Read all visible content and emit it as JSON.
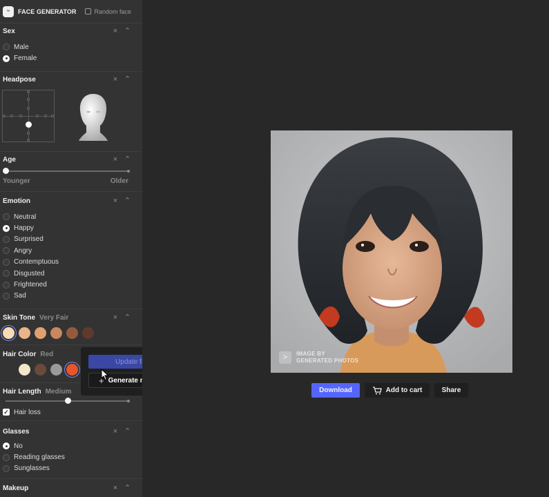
{
  "app": {
    "logo_glyph": "ᵕ",
    "title": "FACE GENERATOR",
    "random_face": "Random face"
  },
  "controls": {
    "close": "×",
    "collapse": "⌃"
  },
  "sex": {
    "title": "Sex",
    "options": [
      {
        "label": "Male",
        "selected": false
      },
      {
        "label": "Female",
        "selected": true
      }
    ]
  },
  "headpose": {
    "title": "Headpose"
  },
  "age": {
    "title": "Age",
    "min_label": "Younger",
    "max_label": "Older",
    "value": 0
  },
  "emotion": {
    "title": "Emotion",
    "options": [
      {
        "label": "Neutral",
        "selected": false
      },
      {
        "label": "Happy",
        "selected": true
      },
      {
        "label": "Surprised",
        "selected": false
      },
      {
        "label": "Angry",
        "selected": false
      },
      {
        "label": "Contemptuous",
        "selected": false
      },
      {
        "label": "Disgusted",
        "selected": false
      },
      {
        "label": "Frightened",
        "selected": false
      },
      {
        "label": "Sad",
        "selected": false
      }
    ]
  },
  "skin_tone": {
    "title": "Skin Tone",
    "value": "Very Fair",
    "colors": [
      "#f6dcb8",
      "#e9b48a",
      "#e0a071",
      "#c8875e",
      "#955a3d",
      "#5e3a2a"
    ],
    "selected_index": 0
  },
  "hair_color": {
    "title": "Hair Color",
    "value": "Red",
    "colors": [
      "#333333",
      "#f4e7c7",
      "#6b4a3a",
      "#9a9a9a",
      "#e8552c"
    ],
    "selected_index": 4
  },
  "hair_length": {
    "title": "Hair Length",
    "value": "Medium",
    "level": 0.5,
    "hair_loss_label": "Hair loss",
    "hair_loss_checked": true
  },
  "glasses": {
    "title": "Glasses",
    "options": [
      {
        "label": "No",
        "selected": true
      },
      {
        "label": "Reading glasses",
        "selected": false
      },
      {
        "label": "Sunglasses",
        "selected": false
      }
    ]
  },
  "makeup": {
    "title": "Makeup"
  },
  "popup": {
    "update_label": "Update face",
    "generate_label": "Generate new face",
    "plus_glyph": "+"
  },
  "photo": {
    "wm_glyph": ">",
    "wm_line1": "IMAGE BY",
    "wm_line2": "GENERATED PHOTOS"
  },
  "actions": {
    "download_label": "Download",
    "cart_label": "Add to cart",
    "share_label": "Share"
  }
}
